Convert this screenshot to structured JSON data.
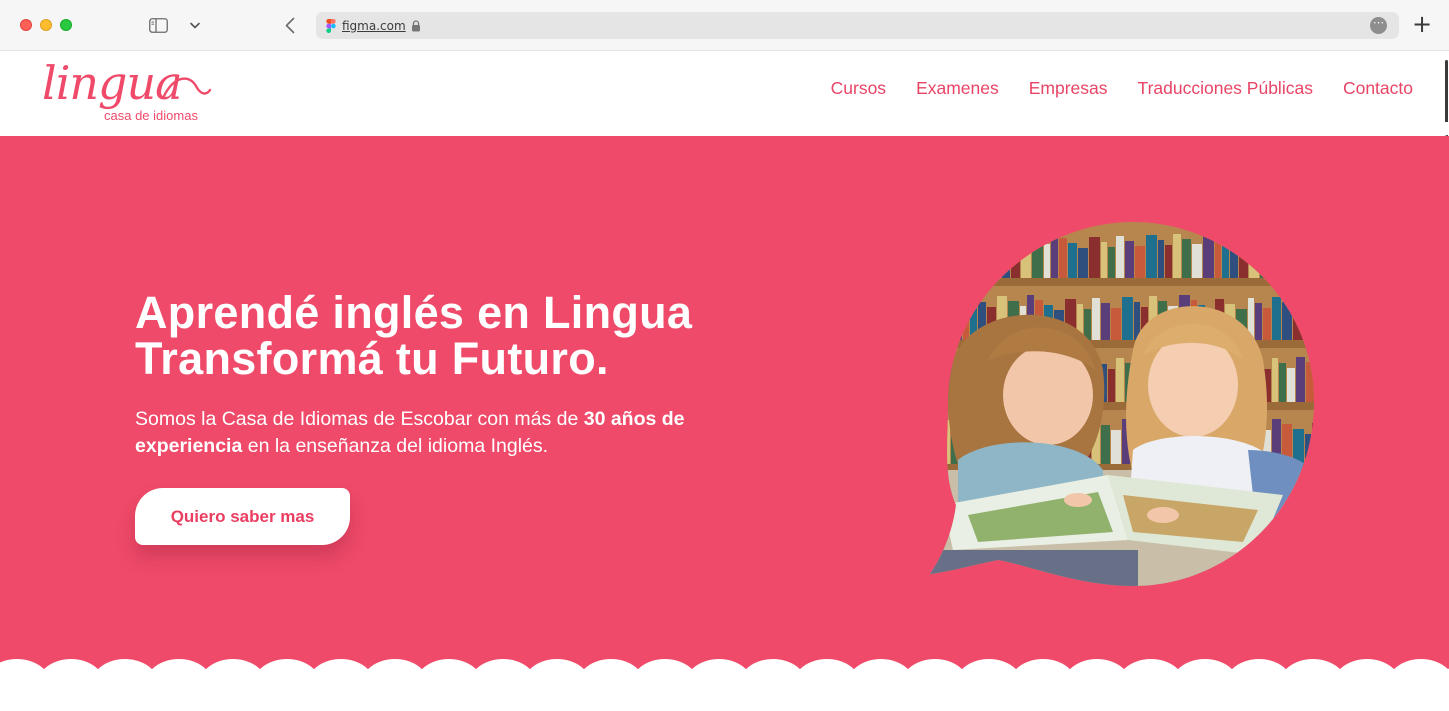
{
  "browser": {
    "url": "figma.com",
    "icons": [
      "sidebar-icon",
      "chevron-down-icon",
      "back-arrow-icon",
      "figma-icon",
      "lock-icon",
      "more-icon",
      "plus-icon"
    ]
  },
  "logo": {
    "word": "lingua",
    "tagline": "casa de idiomas"
  },
  "nav": {
    "items": [
      "Cursos",
      "Examenes",
      "Empresas",
      "Traducciones Públicas",
      "Contacto"
    ]
  },
  "hero": {
    "title_line1": "Aprendé inglés en Lingua",
    "title_line2": "Transformá tu Futuro.",
    "desc_part1": "Somos la Casa de Idiomas de Escobar con más de ",
    "desc_bold1": "30 años de experiencia",
    "desc_part2": " en la enseñanza del idioma Inglés.",
    "cta_label": "Quiero saber mas",
    "image_alt": "Dos niñas leyendo un libro en una biblioteca"
  },
  "colors": {
    "brand_pink": "#ef4a69",
    "white": "#ffffff"
  }
}
